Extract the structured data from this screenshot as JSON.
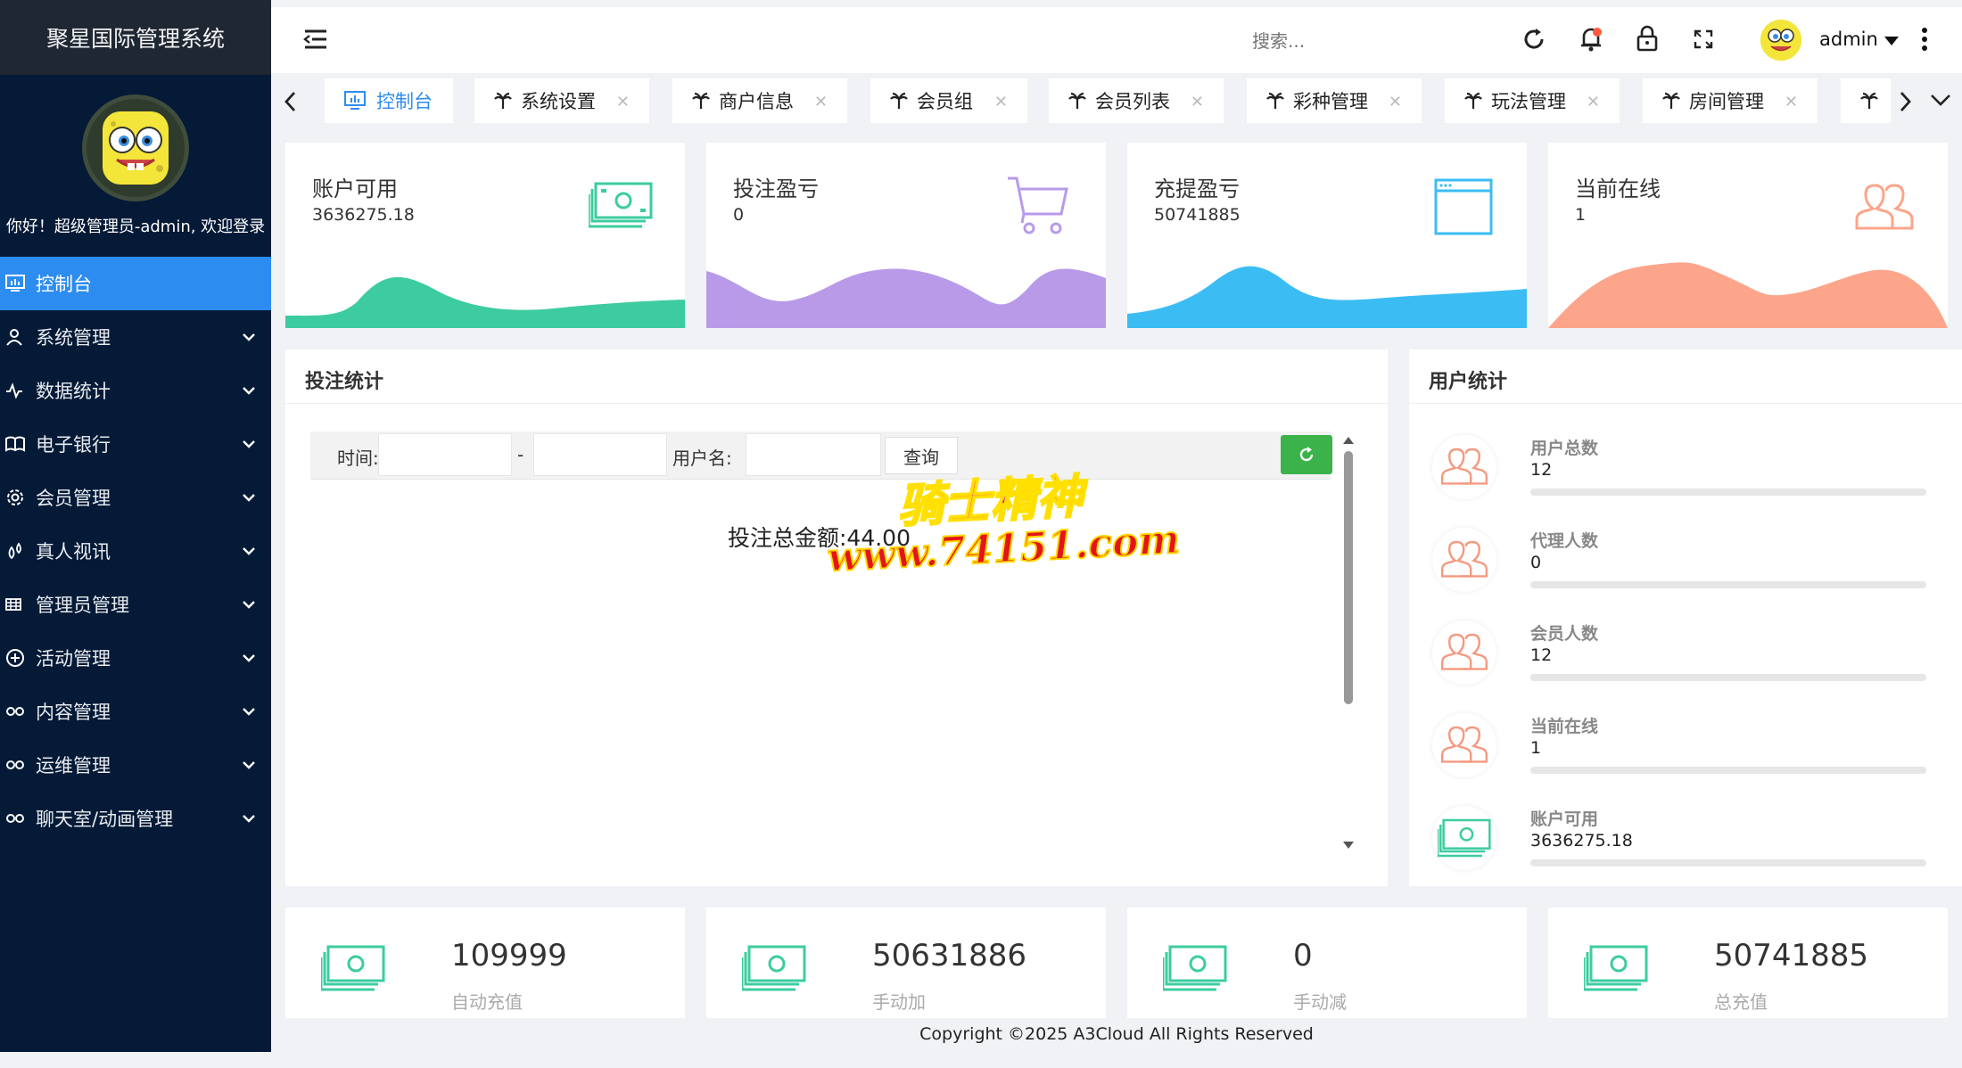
{
  "app": {
    "title": "聚星国际管理系统",
    "welcome": "你好！超级管理员-admin, 欢迎登录"
  },
  "menu": [
    {
      "label": "控制台",
      "icon": "monitor-icon",
      "active": true,
      "expandable": false
    },
    {
      "label": "系统管理",
      "icon": "user-icon",
      "expandable": true
    },
    {
      "label": "数据统计",
      "icon": "pulse-icon",
      "expandable": true
    },
    {
      "label": "电子银行",
      "icon": "bank-icon",
      "expandable": true
    },
    {
      "label": "会员管理",
      "icon": "gear-icon",
      "expandable": true
    },
    {
      "label": "真人视讯",
      "icon": "drops-icon",
      "expandable": true
    },
    {
      "label": "管理员管理",
      "icon": "grid-icon",
      "expandable": true
    },
    {
      "label": "活动管理",
      "icon": "plus-circle-icon",
      "expandable": true
    },
    {
      "label": "内容管理",
      "icon": "link-icon",
      "expandable": true
    },
    {
      "label": "运维管理",
      "icon": "link-icon",
      "expandable": true
    },
    {
      "label": "聊天室/动画管理",
      "icon": "link-icon",
      "expandable": true
    }
  ],
  "topbar": {
    "search_placeholder": "搜索...",
    "username": "admin"
  },
  "tabs": [
    {
      "label": "控制台",
      "active": true,
      "closable": false
    },
    {
      "label": "系统设置",
      "closable": true
    },
    {
      "label": "商户信息",
      "closable": true
    },
    {
      "label": "会员组",
      "closable": true
    },
    {
      "label": "会员列表",
      "closable": true
    },
    {
      "label": "彩种管理",
      "closable": true
    },
    {
      "label": "玩法管理",
      "closable": true
    },
    {
      "label": "房间管理",
      "closable": true
    }
  ],
  "stats": [
    {
      "title": "账户可用",
      "value": "3636275.18",
      "color": "#3dcc9f",
      "icon": "money-icon"
    },
    {
      "title": "投注盈亏",
      "value": "0",
      "color": "#b99ae8",
      "icon": "cart-icon"
    },
    {
      "title": "充提盈亏",
      "value": "50741885",
      "color": "#3bbdf4",
      "icon": "window-icon"
    },
    {
      "title": "当前在线",
      "value": "1",
      "color": "#fca58b",
      "icon": "users-icon"
    }
  ],
  "bet_panel": {
    "title": "投注统计",
    "time_label": "时间:",
    "dash": "-",
    "username_label": "用户名:",
    "query_label": "查询",
    "total_text": "投注总金额:44.00"
  },
  "watermark": {
    "line1": "骑士精神",
    "line2": "www.74151.com"
  },
  "user_panel": {
    "title": "用户统计",
    "rows": [
      {
        "label": "用户总数",
        "value": "12",
        "icon": "users-icon"
      },
      {
        "label": "代理人数",
        "value": "0",
        "icon": "users-icon"
      },
      {
        "label": "会员人数",
        "value": "12",
        "icon": "users-icon"
      },
      {
        "label": "当前在线",
        "value": "1",
        "icon": "users-icon"
      },
      {
        "label": "账户可用",
        "value": "3636275.18",
        "icon": "money-icon"
      }
    ]
  },
  "bottom_stats": [
    {
      "value": "109999",
      "label": "自动充值"
    },
    {
      "value": "50631886",
      "label": "手动加"
    },
    {
      "value": "0",
      "label": "手动减"
    },
    {
      "value": "50741885",
      "label": "总充值"
    }
  ],
  "footer": {
    "copyright": "Copyright ©2025 A3Cloud All Rights Reserved"
  }
}
